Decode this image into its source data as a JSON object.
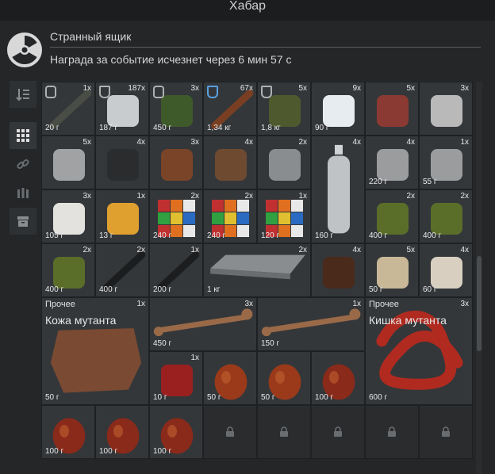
{
  "window": {
    "title": "Хабар"
  },
  "container": {
    "name": "Странный ящик",
    "timer": "Награда за событие исчезнет через 6 мин 57 с"
  },
  "sidebar": {
    "items": [
      {
        "name": "sort-icon",
        "active": false
      },
      {
        "name": "grid-icon",
        "active": true
      },
      {
        "name": "link-icon",
        "active": false
      },
      {
        "name": "ammo-icon",
        "active": false
      },
      {
        "name": "box-icon",
        "active": false
      }
    ]
  },
  "items": [
    {
      "qty": "1x",
      "weight": "20 г",
      "icon": "usb-cable-icon",
      "badge": "link"
    },
    {
      "qty": "187x",
      "weight": "187 г",
      "icon": "scrap-metal-icon",
      "badge": "shield"
    },
    {
      "qty": "3x",
      "weight": "450 г",
      "icon": "circuit-board-icon",
      "badge": "link"
    },
    {
      "qty": "67x",
      "weight": "1,34 кг",
      "icon": "wooden-stick-icon",
      "badge": "blue-cat"
    },
    {
      "qty": "5x",
      "weight": "1,8 кг",
      "icon": "fuel-bag-icon",
      "badge": "shield-fire"
    },
    {
      "qty": "9x",
      "weight": "90 г",
      "icon": "salt-pile-icon"
    },
    {
      "qty": "5x",
      "weight": "",
      "icon": "resistor-icon"
    },
    {
      "qty": "3x",
      "weight": "",
      "icon": "transistor-icon"
    },
    {
      "qty": "5x",
      "weight": "",
      "icon": "crystal-oscillator-icon"
    },
    {
      "qty": "4x",
      "weight": "",
      "icon": "capacitor-icon"
    },
    {
      "qty": "3x",
      "weight": "",
      "icon": "coil-icon"
    },
    {
      "qty": "4x",
      "weight": "",
      "icon": "transformer-icon"
    },
    {
      "qty": "2x",
      "weight": "",
      "icon": "motor-icon"
    },
    {
      "qty": "4x",
      "weight": "160 г",
      "icon": "plastic-bottle-icon"
    },
    {
      "qty": "4x",
      "weight": "220 г",
      "icon": "metal-can-icon"
    },
    {
      "qty": "1x",
      "weight": "55 г",
      "icon": "metal-can-icon"
    },
    {
      "qty": "3x",
      "weight": "105 г",
      "icon": "toilet-paper-icon"
    },
    {
      "qty": "1x",
      "weight": "13 г",
      "icon": "lighter-icon"
    },
    {
      "qty": "2x",
      "weight": "240 г",
      "icon": "rubik-cube-icon"
    },
    {
      "qty": "2x",
      "weight": "240 г",
      "icon": "rubik-cube-icon"
    },
    {
      "qty": "1x",
      "weight": "120 г",
      "icon": "rubik-cube-icon"
    },
    {
      "qty": "2x",
      "weight": "400 г",
      "icon": "gas-mask-filter-icon"
    },
    {
      "qty": "2x",
      "weight": "400 г",
      "icon": "gas-mask-filter-icon"
    },
    {
      "qty": "2x",
      "weight": "400 г",
      "icon": "gas-mask-filter-icon"
    },
    {
      "qty": "2x",
      "weight": "400 г",
      "icon": "tape-strip-icon"
    },
    {
      "qty": "1x",
      "weight": "200 г",
      "icon": "tape-strip-icon"
    },
    {
      "qty": "2x",
      "weight": "1 кг",
      "icon": "metal-plate-icon"
    },
    {
      "qty": "4x",
      "weight": "",
      "icon": "fur-ball-icon"
    },
    {
      "qty": "5x",
      "weight": "50 г",
      "icon": "claw-icon"
    },
    {
      "qty": "4x",
      "weight": "60 г",
      "icon": "tooth-icon"
    },
    {
      "qty": "1x",
      "weight": "50 г",
      "icon": "mutant-skin-icon",
      "category": "Прочее",
      "name": "Кожа мутанта"
    },
    {
      "qty": "3x",
      "weight": "450 г",
      "icon": "bone-icon"
    },
    {
      "qty": "1x",
      "weight": "150 г",
      "icon": "bone-icon"
    },
    {
      "qty": "3x",
      "weight": "600 г",
      "icon": "mutant-gut-icon",
      "category": "Прочее",
      "name": "Кишка мутанта"
    },
    {
      "qty": "1x",
      "weight": "10 г",
      "icon": "spikes-icon"
    },
    {
      "qty": "",
      "weight": "50 г",
      "icon": "heart-organ-icon"
    },
    {
      "qty": "",
      "weight": "50 г",
      "icon": "heart-organ-icon"
    },
    {
      "qty": "",
      "weight": "100 г",
      "icon": "heart-icon"
    },
    {
      "qty": "",
      "weight": "100 г",
      "icon": "heart-icon"
    },
    {
      "qty": "",
      "weight": "100 г",
      "icon": "heart-icon"
    },
    {
      "qty": "",
      "weight": "100 г",
      "icon": "heart-icon"
    }
  ]
}
